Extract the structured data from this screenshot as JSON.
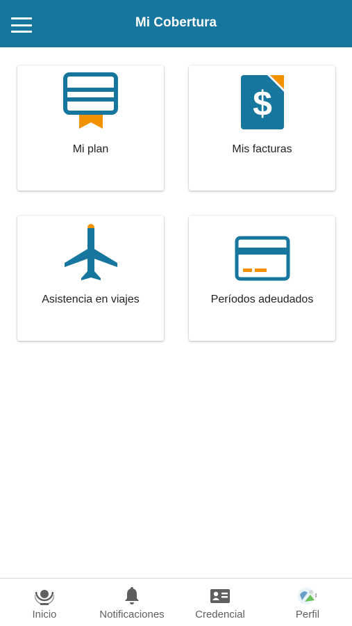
{
  "header": {
    "title": "Mi Cobertura",
    "menu_icon": "hamburger-menu-icon",
    "color": "#16769e"
  },
  "cards": [
    {
      "label": "Mi plan",
      "icon": "membership-card-ribbon-icon"
    },
    {
      "label": "Mis facturas",
      "icon": "dollar-invoice-icon"
    },
    {
      "label": "Asistencia en viajes",
      "icon": "airplane-icon"
    },
    {
      "label": "Períodos adeudados",
      "icon": "credit-card-icon"
    }
  ],
  "colors": {
    "icon_primary": "#16769e",
    "icon_accent": "#f39200",
    "nav_text": "#5f5f5f"
  },
  "bottom_nav": [
    {
      "label": "Inicio",
      "icon": "home-logo-icon"
    },
    {
      "label": "Notificaciones",
      "icon": "bell-icon"
    },
    {
      "label": "Credencial",
      "icon": "id-card-icon"
    },
    {
      "label": "Perfil",
      "icon": "profile-avatar-icon"
    }
  ]
}
